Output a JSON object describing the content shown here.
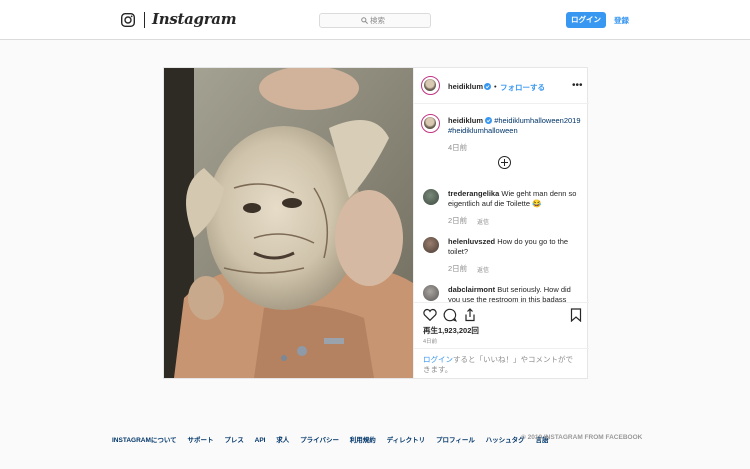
{
  "nav": {
    "logo_text": "Instagram",
    "search_placeholder": "検索",
    "login_button": "ログイン",
    "register_link": "登録"
  },
  "post": {
    "username": "heidiklum",
    "follow_label": "フォローする",
    "separator": "•",
    "more_label": "•••",
    "caption": {
      "username": "heidiklum",
      "hashtags": [
        "#heidiklumhalloween2019",
        "#heidiklumhalloween"
      ],
      "time": "4日前"
    },
    "comments": [
      {
        "username": "trederangelika",
        "text": "Wie geht man denn so eigentlich auf die Toilette 😂",
        "time": "2日前",
        "reply": "返信"
      },
      {
        "username": "helenluvszed",
        "text": "How do you go to the toilet?",
        "time": "2日前",
        "reply": "返信"
      },
      {
        "username": "dabclairmont",
        "text": "But seriously. How did you use the restroom in this badass",
        "time": "",
        "reply": ""
      }
    ],
    "views": "再生1,923,202回",
    "date": "4日前",
    "login_prompt": {
      "link": "ログイン",
      "text": "すると「いいね！」やコメントができます。"
    },
    "icons": {
      "like": "heart-icon",
      "comment": "comment-icon",
      "share": "share-icon",
      "save": "bookmark-icon",
      "verified": "verified-badge-icon"
    }
  },
  "footer": {
    "links": [
      "INSTAGRAMについて",
      "サポート",
      "プレス",
      "API",
      "求人",
      "プライバシー",
      "利用規約",
      "ディレクトリ",
      "プロフィール",
      "ハッシュタグ",
      "言語"
    ],
    "copyright": "© 2019 INSTAGRAM FROM FACEBOOK"
  },
  "colors": {
    "accent": "#3897f0",
    "link_dark": "#003569",
    "text": "#262626",
    "muted": "#8e8e8e",
    "border": "#dbdbdb",
    "background": "#fafafa"
  }
}
